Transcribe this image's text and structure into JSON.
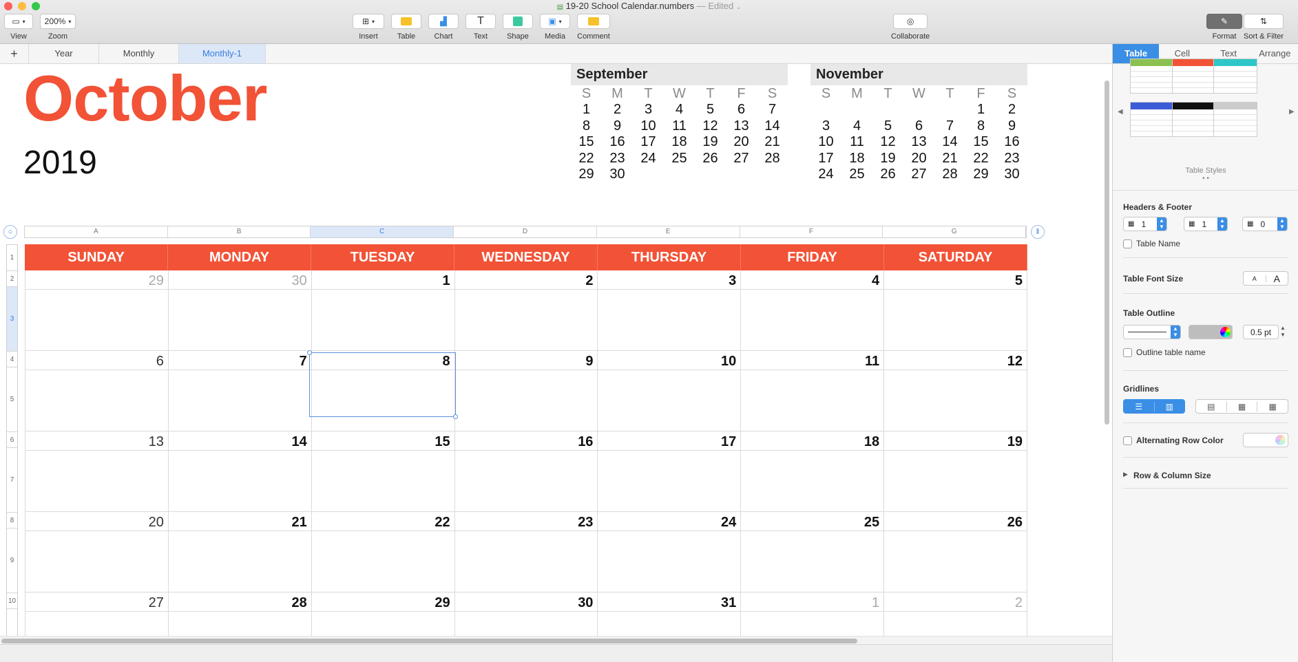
{
  "window": {
    "title": "19-20 School Calendar.numbers",
    "status": "— Edited"
  },
  "toolbar": {
    "view": "View",
    "zoom": "Zoom",
    "zoom_value": "200%",
    "insert": "Insert",
    "table": "Table",
    "chart": "Chart",
    "text": "Text",
    "shape": "Shape",
    "media": "Media",
    "comment": "Comment",
    "collaborate": "Collaborate",
    "format": "Format",
    "sort_filter": "Sort & Filter"
  },
  "sheet_tabs": {
    "add": "+",
    "tabs": [
      "Year",
      "Monthly",
      "Monthly-1"
    ],
    "active": "Monthly-1"
  },
  "header": {
    "month": "October",
    "year": "2019"
  },
  "mini_calendars": [
    {
      "title": "September",
      "day_names": [
        "S",
        "M",
        "T",
        "W",
        "T",
        "F",
        "S"
      ],
      "days": [
        "1",
        "2",
        "3",
        "4",
        "5",
        "6",
        "7",
        "8",
        "9",
        "10",
        "11",
        "12",
        "13",
        "14",
        "15",
        "16",
        "17",
        "18",
        "19",
        "20",
        "21",
        "22",
        "23",
        "24",
        "25",
        "26",
        "27",
        "28",
        "29",
        "30",
        "",
        "",
        "",
        "",
        ""
      ]
    },
    {
      "title": "November",
      "day_names": [
        "S",
        "M",
        "T",
        "W",
        "T",
        "F",
        "S"
      ],
      "days": [
        "",
        "",
        "",
        "",
        "",
        "1",
        "2",
        "3",
        "4",
        "5",
        "6",
        "7",
        "8",
        "9",
        "10",
        "11",
        "12",
        "13",
        "14",
        "15",
        "16",
        "17",
        "18",
        "19",
        "20",
        "21",
        "22",
        "23",
        "24",
        "25",
        "26",
        "27",
        "28",
        "29",
        "30"
      ]
    }
  ],
  "column_headers": [
    "A",
    "B",
    "C",
    "D",
    "E",
    "F",
    "G"
  ],
  "row_headers": [
    "1",
    "2",
    "3",
    "4",
    "5",
    "6",
    "7",
    "8",
    "9",
    "10"
  ],
  "calendar": {
    "weekdays": [
      "SUNDAY",
      "MONDAY",
      "TUESDAY",
      "WEDNESDAY",
      "THURSDAY",
      "FRIDAY",
      "SATURDAY"
    ],
    "weeks": [
      [
        "29",
        "30",
        "1",
        "2",
        "3",
        "4",
        "5"
      ],
      [
        "6",
        "7",
        "8",
        "9",
        "10",
        "11",
        "12"
      ],
      [
        "13",
        "14",
        "15",
        "16",
        "17",
        "18",
        "19"
      ],
      [
        "20",
        "21",
        "22",
        "23",
        "24",
        "25",
        "26"
      ],
      [
        "27",
        "28",
        "29",
        "30",
        "31",
        "1",
        "2"
      ]
    ]
  },
  "inspector": {
    "tabs": [
      "Table",
      "Cell",
      "Text",
      "Arrange"
    ],
    "active_tab": "Table",
    "table_styles_label": "Table Styles",
    "style_colors": [
      "#8cc152",
      "#f25236",
      "#2ec7c9",
      "#3b5bd6",
      "#111111",
      "#cccccc"
    ],
    "headers_footer": {
      "label": "Headers & Footer",
      "header_rows": "1",
      "header_cols": "1",
      "footer_rows": "0"
    },
    "table_name": "Table Name",
    "font_size": {
      "label": "Table Font Size",
      "smaller": "A",
      "larger": "A"
    },
    "outline": {
      "label": "Table Outline",
      "width": "0.5 pt",
      "outline_name": "Outline table name"
    },
    "gridlines": "Gridlines",
    "alternating": "Alternating Row Color",
    "row_col_size": "Row & Column Size"
  }
}
